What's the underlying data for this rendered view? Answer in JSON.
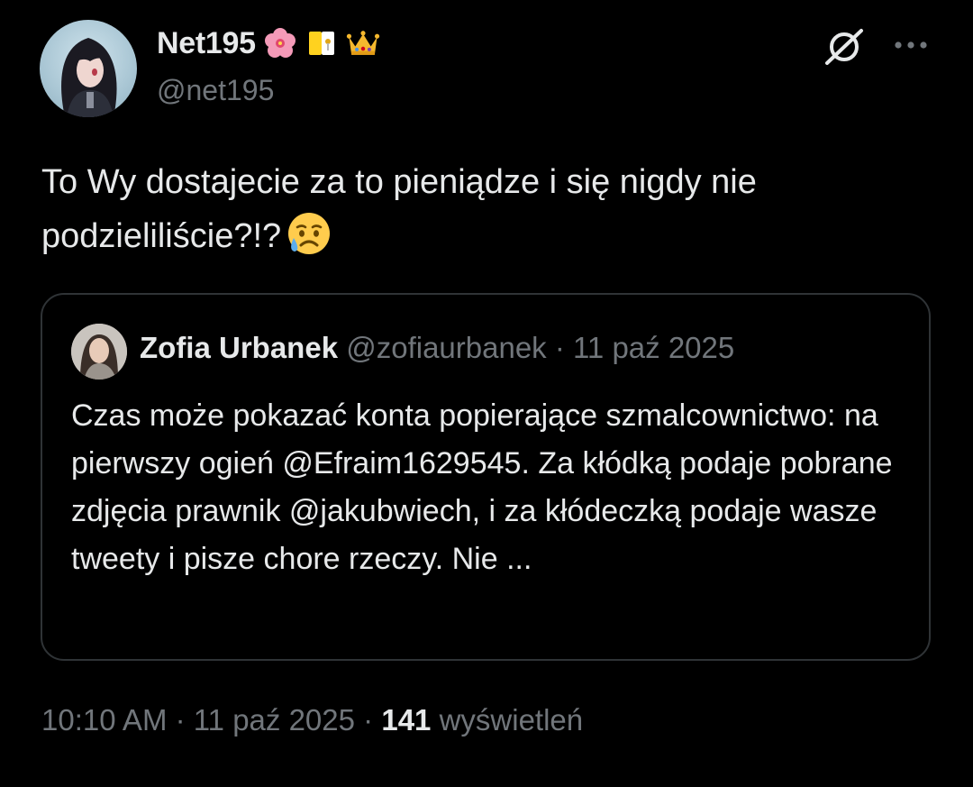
{
  "author": {
    "display_name": "Net195",
    "handle": "@net195",
    "badges": [
      "hibiscus-emoji",
      "vatican-flag-emoji",
      "crown-emoji"
    ]
  },
  "actions": {
    "grok_icon": "grok-icon",
    "more_icon": "more-options-icon"
  },
  "tweet": {
    "text": "To Wy dostajecie za to pieniądze i się nigdy nie podzieliliście?!?",
    "emoji": "sad-but-relieved-face-emoji"
  },
  "quote": {
    "display_name": "Zofia Urbanek",
    "handle": "@zofiaurbanek",
    "separator": "·",
    "date": "11 paź 2025",
    "text": "Czas może pokazać konta popierające szmalcownictwo: na pierwszy ogień @Efraim1629545. Za kłódką podaje pobrane zdjęcia prawnik @jakubwiech, i za kłódeczką podaje wasze tweety i pisze chore rzeczy. Nie ..."
  },
  "meta": {
    "time": "10:10 AM",
    "sep1": "·",
    "date": "11 paź 2025",
    "sep2": "·",
    "views_count": "141",
    "views_label": "wyświetleń"
  },
  "colors": {
    "background": "#000000",
    "primary_text": "#e7e9ea",
    "secondary_text": "#71767b",
    "border": "#2f3336"
  }
}
